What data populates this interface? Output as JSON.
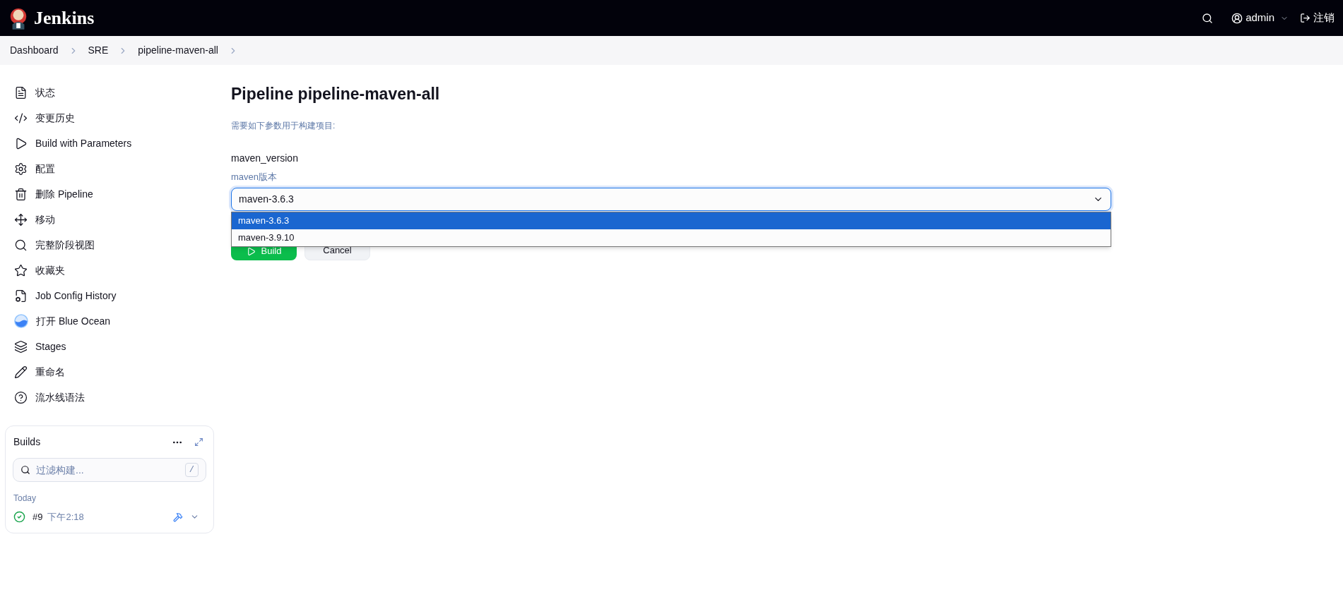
{
  "header": {
    "brand": "Jenkins",
    "user": "admin",
    "logout": "注销"
  },
  "breadcrumbs": [
    "Dashboard",
    "SRE",
    "pipeline-maven-all"
  ],
  "sidebar": {
    "items": [
      {
        "label": "状态"
      },
      {
        "label": "变更历史"
      },
      {
        "label": "Build with Parameters"
      },
      {
        "label": "配置"
      },
      {
        "label": "删除 Pipeline"
      },
      {
        "label": "移动"
      },
      {
        "label": "完整阶段视图"
      },
      {
        "label": "收藏夹"
      },
      {
        "label": "Job Config History"
      },
      {
        "label": "打开 Blue Ocean"
      },
      {
        "label": "Stages"
      },
      {
        "label": "重命名"
      },
      {
        "label": "流水线语法"
      }
    ]
  },
  "builds": {
    "title": "Builds",
    "filter": {
      "placeholder": "过滤构建...",
      "shortcut": "/"
    },
    "group": "Today",
    "rows": [
      {
        "number": "#9",
        "time": "下午2:18"
      }
    ]
  },
  "main": {
    "title": "Pipeline pipeline-maven-all",
    "description": "需要如下参数用于构建项目:",
    "parameter": {
      "name": "maven_version",
      "help": "maven版本",
      "value": "maven-3.6.3",
      "expanded": true,
      "options": [
        {
          "label": "maven-3.6.3",
          "selected": true
        },
        {
          "label": "maven-3.9.10",
          "selected": false
        }
      ]
    },
    "buttons": [
      {
        "label": "Build",
        "kind": "primary"
      },
      {
        "label": "Cancel",
        "kind": "secondary"
      }
    ]
  }
}
